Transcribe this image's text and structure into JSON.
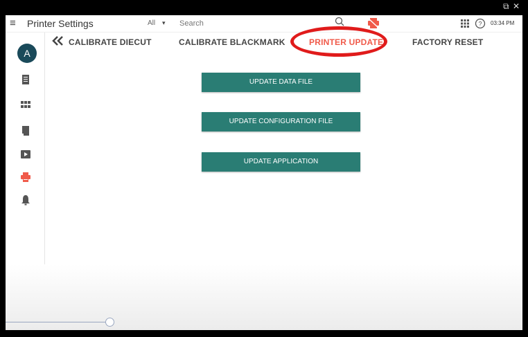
{
  "window": {
    "controls": [
      "⧉",
      "✕"
    ]
  },
  "topbar": {
    "title": "Printer Settings",
    "search_scope": "All",
    "search_placeholder": "Search",
    "clock": "03:34 PM"
  },
  "sidebar": {
    "avatar_initial": "A",
    "items": [
      {
        "icon": "document-icon"
      },
      {
        "icon": "grid-apps-icon"
      },
      {
        "icon": "receipt-icon"
      },
      {
        "icon": "media-play-icon"
      },
      {
        "icon": "printer-icon",
        "active": true
      },
      {
        "icon": "bell-icon"
      }
    ]
  },
  "tabs": {
    "items": [
      {
        "label": "CALIBRATE DIECUT"
      },
      {
        "label": "CALIBRATE BLACKMARK"
      },
      {
        "label": "PRINTER UPDATE",
        "active": true
      },
      {
        "label": "FACTORY RESET"
      }
    ]
  },
  "actions": {
    "update_data_file": "UPDATE DATA FILE",
    "update_config_file": "UPDATE CONFIGURATION FILE",
    "update_application": "UPDATE APPLICATION"
  },
  "colors": {
    "accent_active": "#f05a4a",
    "button": "#2a7d74",
    "avatar": "#1a4a5a",
    "highlight_ring": "#e01b1b"
  }
}
